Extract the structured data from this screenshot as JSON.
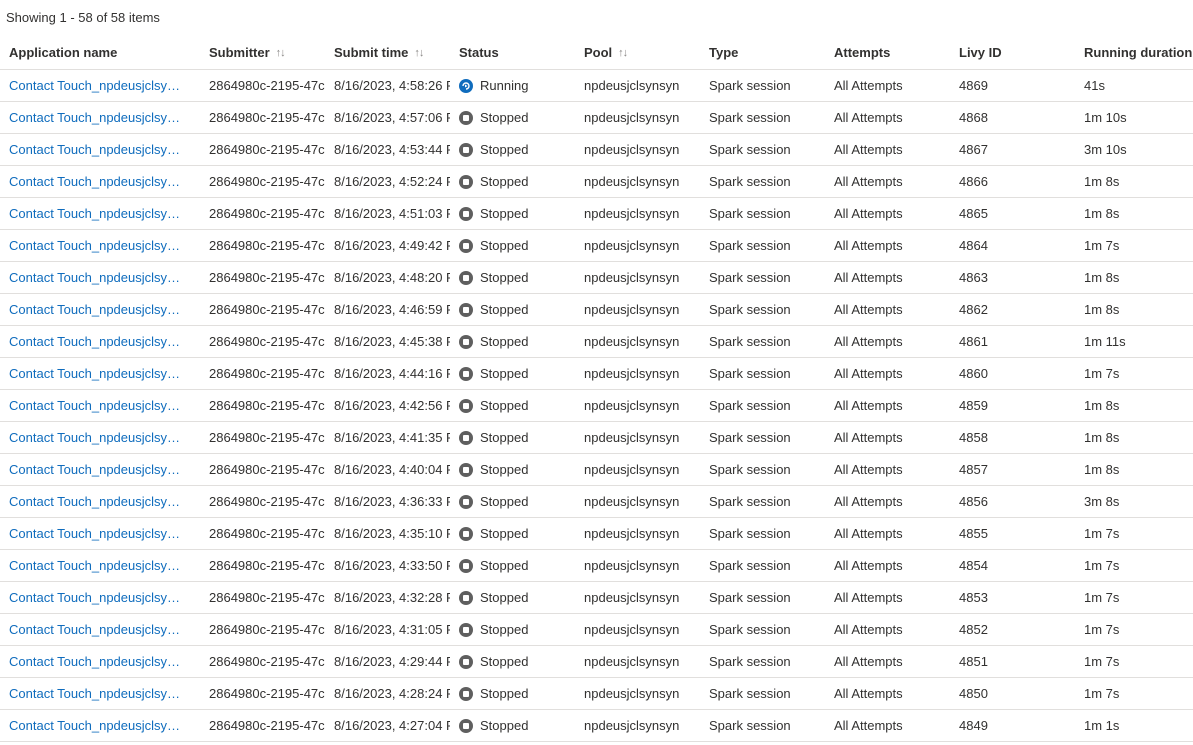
{
  "summary": "Showing 1 - 58 of 58 items",
  "columns": {
    "app": "Application name",
    "submitter": "Submitter",
    "submit_time": "Submit time",
    "status": "Status",
    "pool": "Pool",
    "type": "Type",
    "attempts": "Attempts",
    "livy": "Livy ID",
    "duration": "Running duration"
  },
  "icons": {
    "sort": "sort-updown-icon",
    "running": "running-status-icon",
    "stopped": "stopped-status-icon"
  },
  "colors": {
    "link": "#0f6cbd",
    "running": "#0f6cbd",
    "stopped": "#5f5f5f"
  },
  "rows": [
    {
      "app": "Contact Touch_npdeusjclsynsyn",
      "submitter": "2864980c-2195-47c",
      "submit_time": "8/16/2023, 4:58:26 P",
      "status": "Running",
      "status_kind": "running",
      "pool": "npdeusjclsynsyn",
      "type": "Spark session",
      "attempts": "All Attempts",
      "livy": "4869",
      "duration": "41s"
    },
    {
      "app": "Contact Touch_npdeusjclsynsyn",
      "submitter": "2864980c-2195-47c",
      "submit_time": "8/16/2023, 4:57:06 P",
      "status": "Stopped",
      "status_kind": "stopped",
      "pool": "npdeusjclsynsyn",
      "type": "Spark session",
      "attempts": "All Attempts",
      "livy": "4868",
      "duration": "1m 10s"
    },
    {
      "app": "Contact Touch_npdeusjclsynsyn",
      "submitter": "2864980c-2195-47c",
      "submit_time": "8/16/2023, 4:53:44 P",
      "status": "Stopped",
      "status_kind": "stopped",
      "pool": "npdeusjclsynsyn",
      "type": "Spark session",
      "attempts": "All Attempts",
      "livy": "4867",
      "duration": "3m 10s"
    },
    {
      "app": "Contact Touch_npdeusjclsynsyn",
      "submitter": "2864980c-2195-47c",
      "submit_time": "8/16/2023, 4:52:24 P",
      "status": "Stopped",
      "status_kind": "stopped",
      "pool": "npdeusjclsynsyn",
      "type": "Spark session",
      "attempts": "All Attempts",
      "livy": "4866",
      "duration": "1m 8s"
    },
    {
      "app": "Contact Touch_npdeusjclsynsyn",
      "submitter": "2864980c-2195-47c",
      "submit_time": "8/16/2023, 4:51:03 P",
      "status": "Stopped",
      "status_kind": "stopped",
      "pool": "npdeusjclsynsyn",
      "type": "Spark session",
      "attempts": "All Attempts",
      "livy": "4865",
      "duration": "1m 8s"
    },
    {
      "app": "Contact Touch_npdeusjclsynsyn",
      "submitter": "2864980c-2195-47c",
      "submit_time": "8/16/2023, 4:49:42 P",
      "status": "Stopped",
      "status_kind": "stopped",
      "pool": "npdeusjclsynsyn",
      "type": "Spark session",
      "attempts": "All Attempts",
      "livy": "4864",
      "duration": "1m 7s"
    },
    {
      "app": "Contact Touch_npdeusjclsynsyn",
      "submitter": "2864980c-2195-47c",
      "submit_time": "8/16/2023, 4:48:20 P",
      "status": "Stopped",
      "status_kind": "stopped",
      "pool": "npdeusjclsynsyn",
      "type": "Spark session",
      "attempts": "All Attempts",
      "livy": "4863",
      "duration": "1m 8s"
    },
    {
      "app": "Contact Touch_npdeusjclsynsyn",
      "submitter": "2864980c-2195-47c",
      "submit_time": "8/16/2023, 4:46:59 P",
      "status": "Stopped",
      "status_kind": "stopped",
      "pool": "npdeusjclsynsyn",
      "type": "Spark session",
      "attempts": "All Attempts",
      "livy": "4862",
      "duration": "1m 8s"
    },
    {
      "app": "Contact Touch_npdeusjclsynsyn",
      "submitter": "2864980c-2195-47c",
      "submit_time": "8/16/2023, 4:45:38 P",
      "status": "Stopped",
      "status_kind": "stopped",
      "pool": "npdeusjclsynsyn",
      "type": "Spark session",
      "attempts": "All Attempts",
      "livy": "4861",
      "duration": "1m 11s"
    },
    {
      "app": "Contact Touch_npdeusjclsynsyn",
      "submitter": "2864980c-2195-47c",
      "submit_time": "8/16/2023, 4:44:16 P",
      "status": "Stopped",
      "status_kind": "stopped",
      "pool": "npdeusjclsynsyn",
      "type": "Spark session",
      "attempts": "All Attempts",
      "livy": "4860",
      "duration": "1m 7s"
    },
    {
      "app": "Contact Touch_npdeusjclsynsyn",
      "submitter": "2864980c-2195-47c",
      "submit_time": "8/16/2023, 4:42:56 P",
      "status": "Stopped",
      "status_kind": "stopped",
      "pool": "npdeusjclsynsyn",
      "type": "Spark session",
      "attempts": "All Attempts",
      "livy": "4859",
      "duration": "1m 8s"
    },
    {
      "app": "Contact Touch_npdeusjclsynsyn",
      "submitter": "2864980c-2195-47c",
      "submit_time": "8/16/2023, 4:41:35 P",
      "status": "Stopped",
      "status_kind": "stopped",
      "pool": "npdeusjclsynsyn",
      "type": "Spark session",
      "attempts": "All Attempts",
      "livy": "4858",
      "duration": "1m 8s"
    },
    {
      "app": "Contact Touch_npdeusjclsynsyn",
      "submitter": "2864980c-2195-47c",
      "submit_time": "8/16/2023, 4:40:04 P",
      "status": "Stopped",
      "status_kind": "stopped",
      "pool": "npdeusjclsynsyn",
      "type": "Spark session",
      "attempts": "All Attempts",
      "livy": "4857",
      "duration": "1m 8s"
    },
    {
      "app": "Contact Touch_npdeusjclsynsyn",
      "submitter": "2864980c-2195-47c",
      "submit_time": "8/16/2023, 4:36:33 P",
      "status": "Stopped",
      "status_kind": "stopped",
      "pool": "npdeusjclsynsyn",
      "type": "Spark session",
      "attempts": "All Attempts",
      "livy": "4856",
      "duration": "3m 8s"
    },
    {
      "app": "Contact Touch_npdeusjclsynsyn",
      "submitter": "2864980c-2195-47c",
      "submit_time": "8/16/2023, 4:35:10 P",
      "status": "Stopped",
      "status_kind": "stopped",
      "pool": "npdeusjclsynsyn",
      "type": "Spark session",
      "attempts": "All Attempts",
      "livy": "4855",
      "duration": "1m 7s"
    },
    {
      "app": "Contact Touch_npdeusjclsynsyn",
      "submitter": "2864980c-2195-47c",
      "submit_time": "8/16/2023, 4:33:50 P",
      "status": "Stopped",
      "status_kind": "stopped",
      "pool": "npdeusjclsynsyn",
      "type": "Spark session",
      "attempts": "All Attempts",
      "livy": "4854",
      "duration": "1m 7s"
    },
    {
      "app": "Contact Touch_npdeusjclsynsyn",
      "submitter": "2864980c-2195-47c",
      "submit_time": "8/16/2023, 4:32:28 P",
      "status": "Stopped",
      "status_kind": "stopped",
      "pool": "npdeusjclsynsyn",
      "type": "Spark session",
      "attempts": "All Attempts",
      "livy": "4853",
      "duration": "1m 7s"
    },
    {
      "app": "Contact Touch_npdeusjclsynsyn",
      "submitter": "2864980c-2195-47c",
      "submit_time": "8/16/2023, 4:31:05 P",
      "status": "Stopped",
      "status_kind": "stopped",
      "pool": "npdeusjclsynsyn",
      "type": "Spark session",
      "attempts": "All Attempts",
      "livy": "4852",
      "duration": "1m 7s"
    },
    {
      "app": "Contact Touch_npdeusjclsynsyn",
      "submitter": "2864980c-2195-47c",
      "submit_time": "8/16/2023, 4:29:44 P",
      "status": "Stopped",
      "status_kind": "stopped",
      "pool": "npdeusjclsynsyn",
      "type": "Spark session",
      "attempts": "All Attempts",
      "livy": "4851",
      "duration": "1m 7s"
    },
    {
      "app": "Contact Touch_npdeusjclsynsyn",
      "submitter": "2864980c-2195-47c",
      "submit_time": "8/16/2023, 4:28:24 P",
      "status": "Stopped",
      "status_kind": "stopped",
      "pool": "npdeusjclsynsyn",
      "type": "Spark session",
      "attempts": "All Attempts",
      "livy": "4850",
      "duration": "1m 7s"
    },
    {
      "app": "Contact Touch_npdeusjclsynsyn",
      "submitter": "2864980c-2195-47c",
      "submit_time": "8/16/2023, 4:27:04 P",
      "status": "Stopped",
      "status_kind": "stopped",
      "pool": "npdeusjclsynsyn",
      "type": "Spark session",
      "attempts": "All Attempts",
      "livy": "4849",
      "duration": "1m 1s"
    }
  ]
}
